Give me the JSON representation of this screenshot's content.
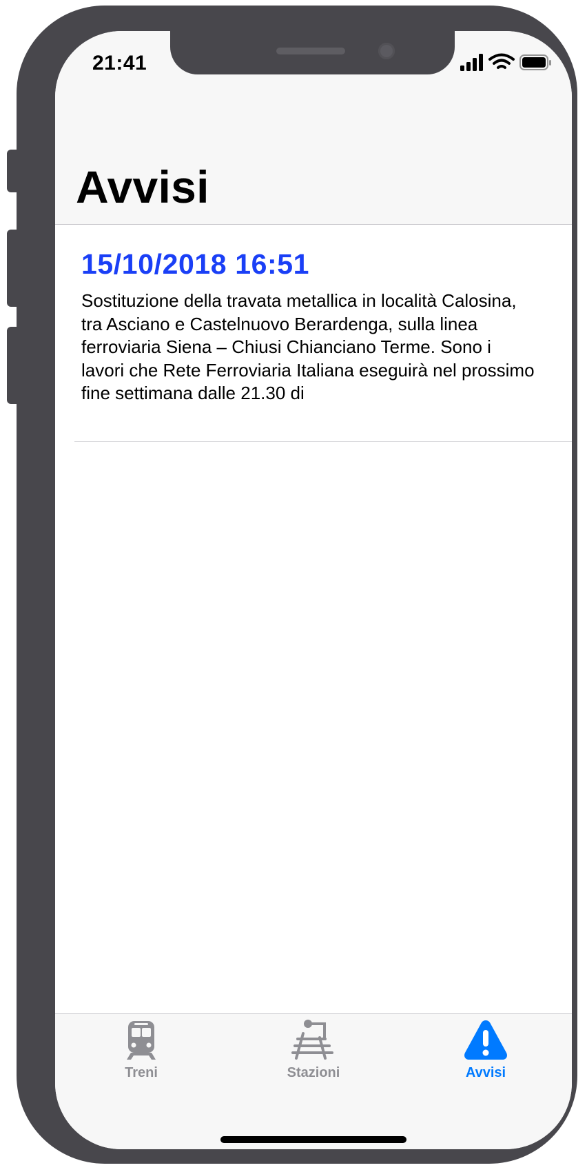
{
  "status_bar": {
    "time": "21:41"
  },
  "nav": {
    "title": "Avvisi"
  },
  "notices": [
    {
      "date": "15/10/2018 16:51",
      "text": "Sostituzione della travata metallica in località Calosina, tra Asciano e Castelnuovo Berardenga, sulla linea ferroviaria Siena – Chiusi Chianciano Terme. Sono i lavori che Rete Ferroviaria Italiana eseguirà nel prossimo fine settimana dalle 21.30 di"
    }
  ],
  "tabbar": {
    "items": [
      {
        "label": "Treni",
        "icon": "train-icon",
        "selected": false
      },
      {
        "label": "Stazioni",
        "icon": "railway-station-icon",
        "selected": false
      },
      {
        "label": "Avvisi",
        "icon": "warning-icon",
        "selected": true
      }
    ]
  },
  "colors": {
    "accent": "#007aff",
    "date_blue": "#1a3ff6",
    "tab_inactive": "#8e8e93",
    "device_frame": "#48474c"
  }
}
